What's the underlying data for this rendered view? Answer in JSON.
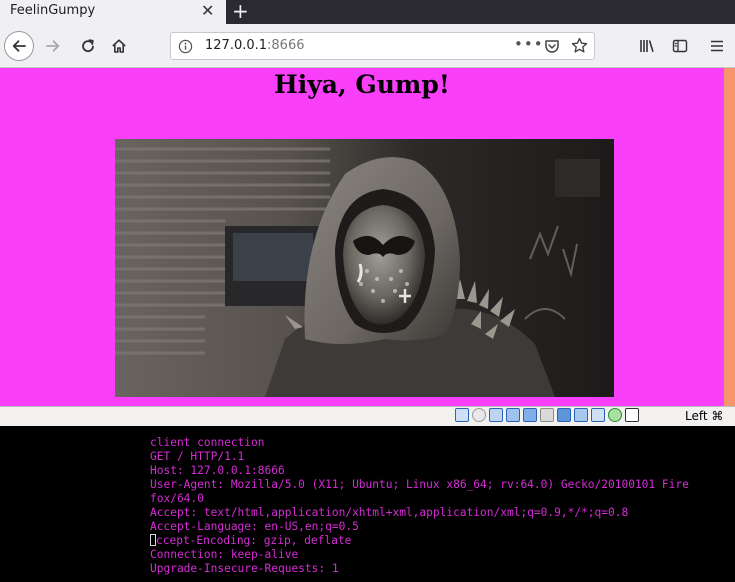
{
  "browser": {
    "tab": {
      "title": "FeelinGumpy",
      "close_glyph": "✕"
    },
    "new_tab_glyph": "+",
    "url": {
      "host": "127.0.0.1",
      "port": ":8666",
      "more_glyph": "•••"
    }
  },
  "page": {
    "heading": "Hiya, Gump!",
    "background_color": "#fa3ffa"
  },
  "vbox": {
    "icons": [
      "hard-disk-icon",
      "optical-drive-icon",
      "audio-icon",
      "network-icon",
      "usb-icon",
      "shared-folder-icon",
      "display-icon",
      "video-capture-icon",
      "capture-mouse-icon",
      "cpu-icon",
      "recording-icon",
      "keyboard-icon"
    ],
    "host_key": "Left ⌘"
  },
  "terminal": {
    "text_color": "#d62bd6",
    "lines": [
      "client connection",
      "GET / HTTP/1.1",
      "Host: 127.0.0.1:8666",
      "User-Agent: Mozilla/5.0 (X11; Ubuntu; Linux x86_64; rv:64.0) Gecko/20100101 Fire",
      "fox/64.0",
      "Accept: text/html,application/xhtml+xml,application/xml;q=0.9,*/*;q=0.8",
      "Accept-Language: en-US,en;q=0.5",
      "ccept-Encoding: gzip, deflate",
      "Connection: keep-alive",
      "Upgrade-Insecure-Requests: 1"
    ]
  }
}
